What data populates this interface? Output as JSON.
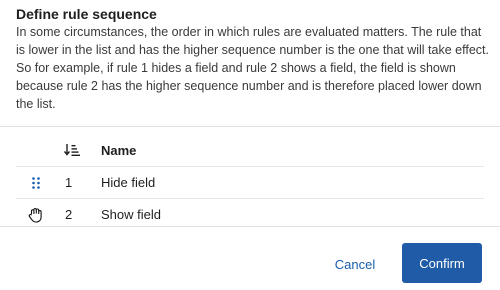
{
  "dialog": {
    "title": "Define rule sequence",
    "description": "In some circumstances, the order in which rules are evaluated matters. The rule that is lower in the list and has the higher sequence number is the one that will take effect. So for example, if rule 1 hides a field and rule 2 shows a field, the field is shown because rule 2 has the higher sequence number and is therefore placed lower down the list."
  },
  "table": {
    "header": {
      "sort_icon": "sort-descending-icon",
      "name_label": "Name"
    },
    "rows": [
      {
        "sequence": "1",
        "name": "Hide field",
        "handle_icon": "drag-handle-icon"
      },
      {
        "sequence": "2",
        "name": "Show field",
        "handle_icon": "grab-hand-cursor-icon"
      }
    ]
  },
  "footer": {
    "cancel_label": "Cancel",
    "confirm_label": "Confirm"
  },
  "colors": {
    "primary": "#1f5ba7",
    "link": "#1a5fad",
    "text": "#1f1f1f"
  }
}
